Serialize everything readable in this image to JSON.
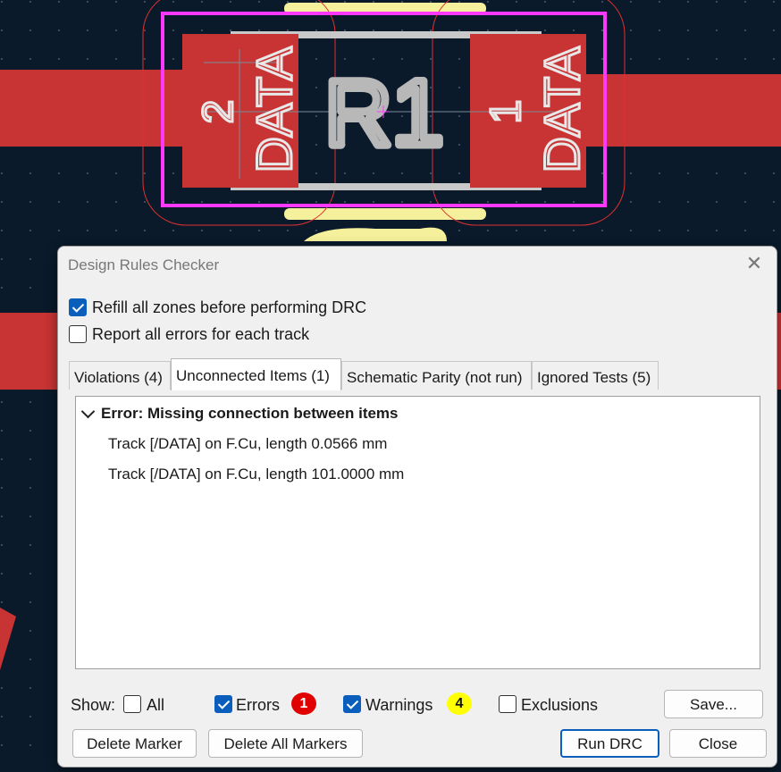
{
  "pcb": {
    "reference": "R1",
    "pads": [
      {
        "number": "2",
        "net": "DATA"
      },
      {
        "number": "1",
        "net": "DATA"
      }
    ],
    "colors": {
      "background": "#0a1a2a",
      "copper": "#c83434",
      "silkscreen": "#c8c8c8",
      "courtyard": "#ff38ff",
      "fab": "#f4f09c"
    }
  },
  "dialog": {
    "title": "Design Rules Checker",
    "options": {
      "refill_zones": {
        "label": "Refill all zones before performing DRC",
        "checked": true
      },
      "report_all_errors": {
        "label": "Report all errors for each track",
        "checked": false
      }
    },
    "tabs": [
      {
        "label": "Violations (4)",
        "active": false
      },
      {
        "label": "Unconnected Items (1)",
        "active": true
      },
      {
        "label": "Schematic Parity (not run)",
        "active": false
      },
      {
        "label": "Ignored Tests (5)",
        "active": false
      }
    ],
    "unconnected": {
      "group_label": "Error: Missing connection between items",
      "items": [
        "Track [/DATA] on F.Cu, length 0.0566 mm",
        "Track [/DATA] on F.Cu, length 101.0000 mm"
      ]
    },
    "show": {
      "label": "Show:",
      "all": {
        "label": "All",
        "checked": false
      },
      "errors": {
        "label": "Errors",
        "checked": true,
        "count": "1",
        "color": "#e00000"
      },
      "warnings": {
        "label": "Warnings",
        "checked": true,
        "count": "4",
        "color": "#ffff00"
      },
      "exclusions": {
        "label": "Exclusions",
        "checked": false
      }
    },
    "buttons": {
      "save": "Save...",
      "delete_marker": "Delete Marker",
      "delete_all_markers": "Delete All Markers",
      "run_drc": "Run DRC",
      "close": "Close"
    }
  }
}
